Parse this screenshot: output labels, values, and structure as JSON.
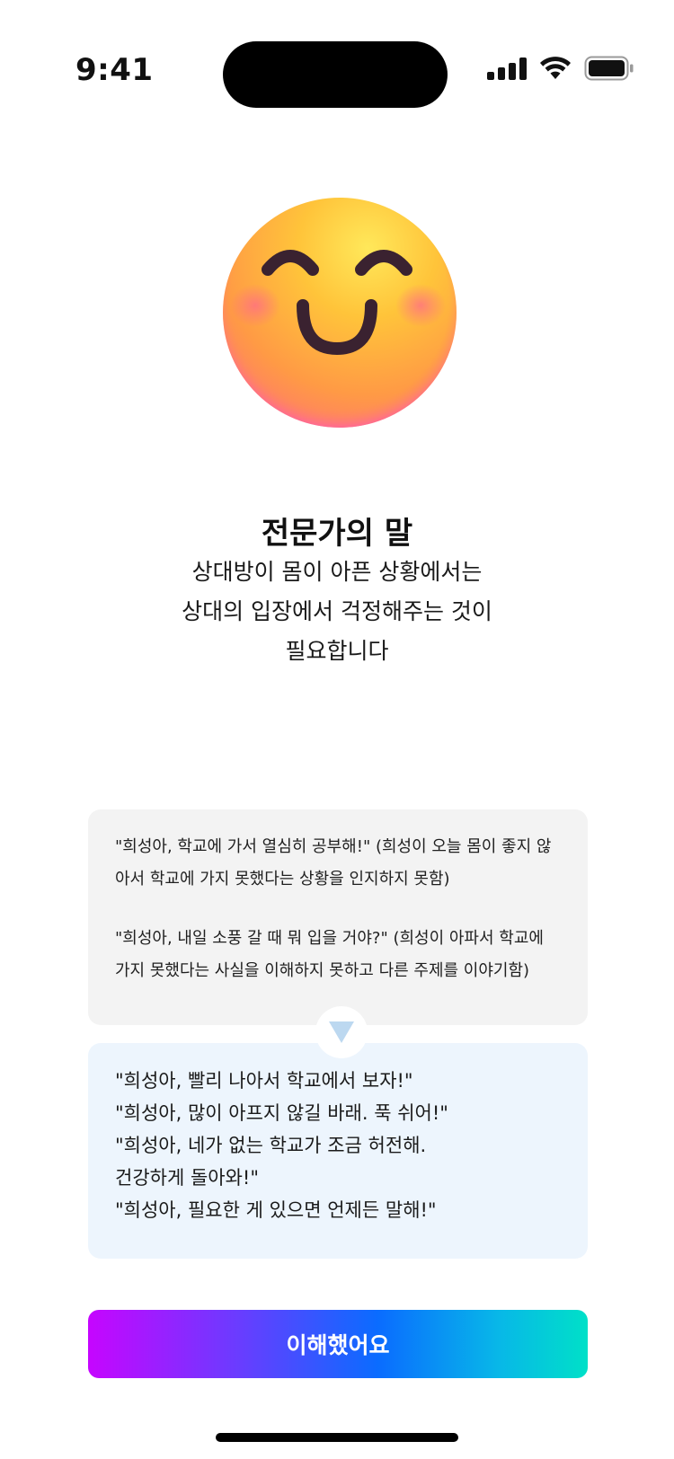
{
  "status_bar": {
    "time": "9:41",
    "icons": [
      "signal-icon",
      "wifi-icon",
      "battery-icon"
    ]
  },
  "emoji": {
    "icon": "smiling-face-emoji"
  },
  "expert": {
    "title": "전문가의 말",
    "lines": [
      "상대방이 몸이 아픈 상황에서는",
      "상대의 입장에서 걱정해주는 것이",
      "필요합니다"
    ]
  },
  "bad_examples": [
    "\"희성아, 학교에 가서 열심히 공부해!\" (희성이 오늘 몸이 좋지 않아서 학교에 가지 못했다는 상황을 인지하지 못함)",
    "\"희성아, 내일 소풍 갈 때 뭐 입을 거야?\" (희성이 아파서 학교에 가지 못했다는 사실을 이해하지 못하고 다른 주제를 이야기함)"
  ],
  "good_examples": [
    "\"희성아, 빨리 나아서 학교에서 보자!\"",
    "\"희성아, 많이 아프지 않길 바래. 푹 쉬어!\"",
    "\"희성아, 네가 없는 학교가 조금 허전해.",
    "건강하게 돌아와!\"",
    "\"희성아, 필요한 게 있으면 언제든 말해!\""
  ],
  "button": {
    "label": "이해했어요"
  },
  "colors": {
    "bad_card_bg": "#f3f3f3",
    "good_card_bg": "#edf5fd",
    "arrow": "#bcd8f0",
    "button_gradient": [
      "#c605ff",
      "#0a6cff",
      "#00e0c8"
    ]
  }
}
